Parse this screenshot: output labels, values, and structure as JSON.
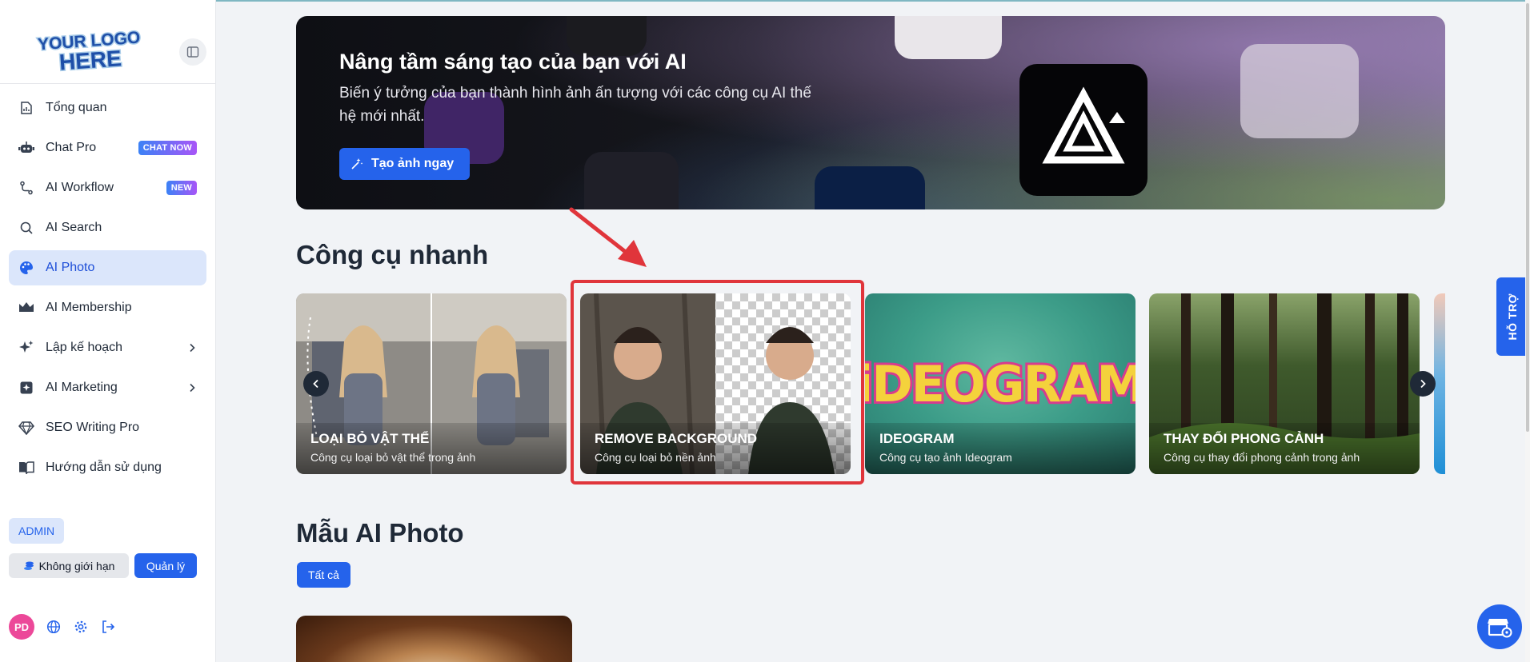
{
  "brand": {
    "logo_line1": "YOUR LOGO",
    "logo_line2": "HERE"
  },
  "sidebar": {
    "items": [
      {
        "label": "Tổng quan",
        "icon": "chart-report-icon"
      },
      {
        "label": "Chat Pro",
        "icon": "robot-icon",
        "badge": "CHAT NOW"
      },
      {
        "label": "AI Workflow",
        "icon": "workflow-icon",
        "badge": "NEW"
      },
      {
        "label": "AI Search",
        "icon": "search-icon"
      },
      {
        "label": "AI Photo",
        "icon": "palette-icon",
        "active": true
      },
      {
        "label": "AI Membership",
        "icon": "crown-icon"
      },
      {
        "label": "Lập kế hoạch",
        "icon": "sparkle-icon",
        "has_submenu": true
      },
      {
        "label": "AI Marketing",
        "icon": "marketing-icon",
        "has_submenu": true
      },
      {
        "label": "SEO Writing Pro",
        "icon": "diamond-icon"
      },
      {
        "label": "Hướng dẫn sử dụng",
        "icon": "book-icon"
      }
    ],
    "role": "ADMIN",
    "quota_label": "Không giới hạn",
    "manage_label": "Quản lý",
    "user_initials": "PD"
  },
  "hero": {
    "title": "Nâng tầm sáng tạo của bạn với AI",
    "subtitle": "Biến ý tưởng của bạn thành hình ảnh ấn tượng với các công cụ AI thế hệ mới nhất.",
    "cta": "Tạo ảnh ngay"
  },
  "quick_tools": {
    "heading": "Công cụ nhanh",
    "cards": [
      {
        "title": "LOẠI BỎ VẬT THỂ",
        "desc": "Công cụ loại bỏ vật thể trong ảnh"
      },
      {
        "title": "REMOVE BACKGROUND",
        "desc": "Công cụ loại bỏ nền ảnh",
        "highlighted": true
      },
      {
        "title": "IDEOGRAM",
        "desc": "Công cụ tạo ảnh Ideogram"
      },
      {
        "title": "THAY ĐỔI PHONG CẢNH",
        "desc": "Công cụ thay đổi phong cảnh trong ảnh"
      }
    ]
  },
  "templates": {
    "heading": "Mẫu AI Photo",
    "filter_all": "Tất cả"
  },
  "ideogram_art": "iDEOGRAM",
  "support_label": "HỖ TRỢ",
  "colors": {
    "primary": "#2563eb",
    "active_bg": "#dbe6fb",
    "highlight": "#e0353b",
    "avatar": "#ec4899"
  }
}
